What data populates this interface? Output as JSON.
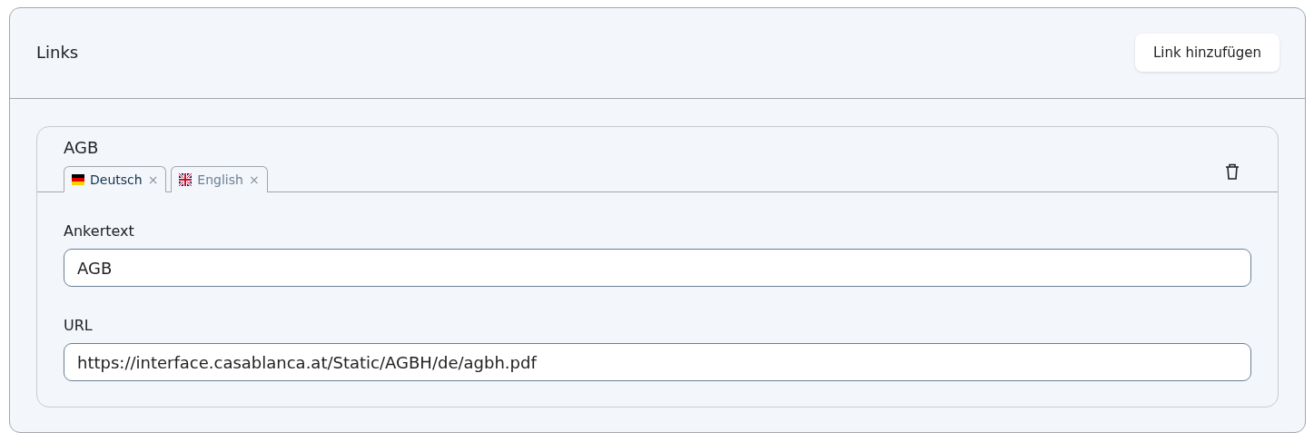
{
  "header": {
    "title": "Links",
    "add_button": "Link hinzufügen"
  },
  "links": [
    {
      "title": "AGB",
      "tabs": [
        {
          "label": "Deutsch",
          "kind": "de",
          "selected": true,
          "close": "×"
        },
        {
          "label": "English",
          "kind": "gb",
          "selected": false,
          "close": "×"
        }
      ],
      "fields": [
        {
          "label": "Ankertext",
          "value": "AGB"
        },
        {
          "label": "URL",
          "value": "https://interface.casablanca.at/Static/AGBH/de/agbh.pdf"
        }
      ]
    }
  ]
}
